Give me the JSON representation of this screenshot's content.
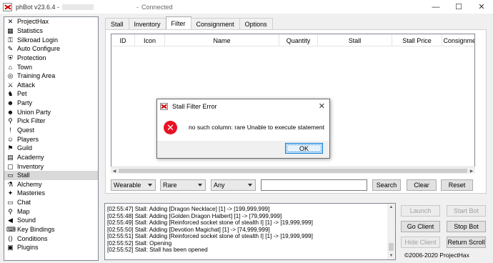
{
  "window": {
    "title": "phBot v23.6.4 -",
    "title_separator": "-",
    "status": "Connected",
    "controls": {
      "minimize": "—",
      "maximize": "☐",
      "close": "✕"
    }
  },
  "sidebar": {
    "items": [
      {
        "label": "ProjectHax",
        "icon": "projecthax-icon",
        "glyph": "✕"
      },
      {
        "label": "Statistics",
        "icon": "statistics-icon",
        "glyph": "▦"
      },
      {
        "label": "Silkroad Login",
        "icon": "key-icon",
        "glyph": "⚿"
      },
      {
        "label": "Auto Configure",
        "icon": "wrench-icon",
        "glyph": "✎"
      },
      {
        "label": "Protection",
        "icon": "shield-icon",
        "glyph": "⛨"
      },
      {
        "label": "Town",
        "icon": "town-icon",
        "glyph": "⌂"
      },
      {
        "label": "Training Area",
        "icon": "target-icon",
        "glyph": "◎"
      },
      {
        "label": "Attack",
        "icon": "sword-icon",
        "glyph": "⚔"
      },
      {
        "label": "Pet",
        "icon": "pet-icon",
        "glyph": "♞"
      },
      {
        "label": "Party",
        "icon": "party-icon",
        "glyph": "☻"
      },
      {
        "label": "Union Party",
        "icon": "union-icon",
        "glyph": "☻"
      },
      {
        "label": "Pick Filter",
        "icon": "filter-icon",
        "glyph": "⚲"
      },
      {
        "label": "Quest",
        "icon": "quest-icon",
        "glyph": "!"
      },
      {
        "label": "Players",
        "icon": "players-icon",
        "glyph": "☺"
      },
      {
        "label": "Guild",
        "icon": "guild-icon",
        "glyph": "⚑"
      },
      {
        "label": "Academy",
        "icon": "academy-icon",
        "glyph": "▤"
      },
      {
        "label": "Inventory",
        "icon": "inventory-icon",
        "glyph": "▢"
      },
      {
        "label": "Stall",
        "icon": "stall-icon",
        "glyph": "▭"
      },
      {
        "label": "Alchemy",
        "icon": "alchemy-icon",
        "glyph": "⚗"
      },
      {
        "label": "Masteries",
        "icon": "masteries-icon",
        "glyph": "✦"
      },
      {
        "label": "Chat",
        "icon": "chat-icon",
        "glyph": "▭"
      },
      {
        "label": "Map",
        "icon": "map-pin-icon",
        "glyph": "⚲"
      },
      {
        "label": "Sound",
        "icon": "speaker-icon",
        "glyph": "◀"
      },
      {
        "label": "Key Bindings",
        "icon": "keyboard-icon",
        "glyph": "⌨"
      },
      {
        "label": "Conditions",
        "icon": "code-icon",
        "glyph": "⟨⟩"
      },
      {
        "label": "Plugins",
        "icon": "plugins-icon",
        "glyph": "▣"
      }
    ],
    "selected": "Stall"
  },
  "tabs": [
    "Stall",
    "Inventory",
    "Filter",
    "Consignment",
    "Options"
  ],
  "active_tab": "Filter",
  "listview": {
    "columns": [
      "ID",
      "Icon",
      "Name",
      "Quantity",
      "Stall",
      "Stall Price",
      "Consignment"
    ],
    "rows": []
  },
  "filters": {
    "type": "Wearable",
    "rarity": "Rare",
    "degree": "Any",
    "search_value": "",
    "search_label": "Search",
    "clear_label": "Clear",
    "reset_label": "Reset"
  },
  "log": [
    "[02:55:47] Stall: Adding [Dragon Necklace] [1] -> [199,999,999]",
    "[02:55:48] Stall: Adding [Golden Dragon Halbert] [1] -> [79,999,999]",
    "[02:55:49] Stall: Adding [Reinforced socket stone of stealth I] [1] -> [19,999,999]",
    "[02:55:50] Stall: Adding [Devotion Magichat] [1] -> [74,999,999]",
    "[02:55:51] Stall: Adding [Reinforced socket stone of stealth I] [1] -> [19,999,999]",
    "[02:55:52] Stall: Opening",
    "[02:55:52] Stall: Stall has been opened"
  ],
  "controls": {
    "launch": "Launch",
    "start_bot": "Start Bot",
    "go_client": "Go Client",
    "stop_bot": "Stop Bot",
    "hide_client": "Hide Client",
    "return_scroll": "Return Scroll",
    "copyright": "©2006-2020 ProjectHax"
  },
  "dialog": {
    "title": "Stall Filter Error",
    "message": "no such column: rare Unable to execute statement",
    "ok_label": "OK",
    "close": "✕",
    "error_glyph": "✕"
  },
  "colors": {
    "error_red": "#e81123",
    "selection_gray": "#d9d9d9",
    "focus_blue": "#0078d7"
  }
}
